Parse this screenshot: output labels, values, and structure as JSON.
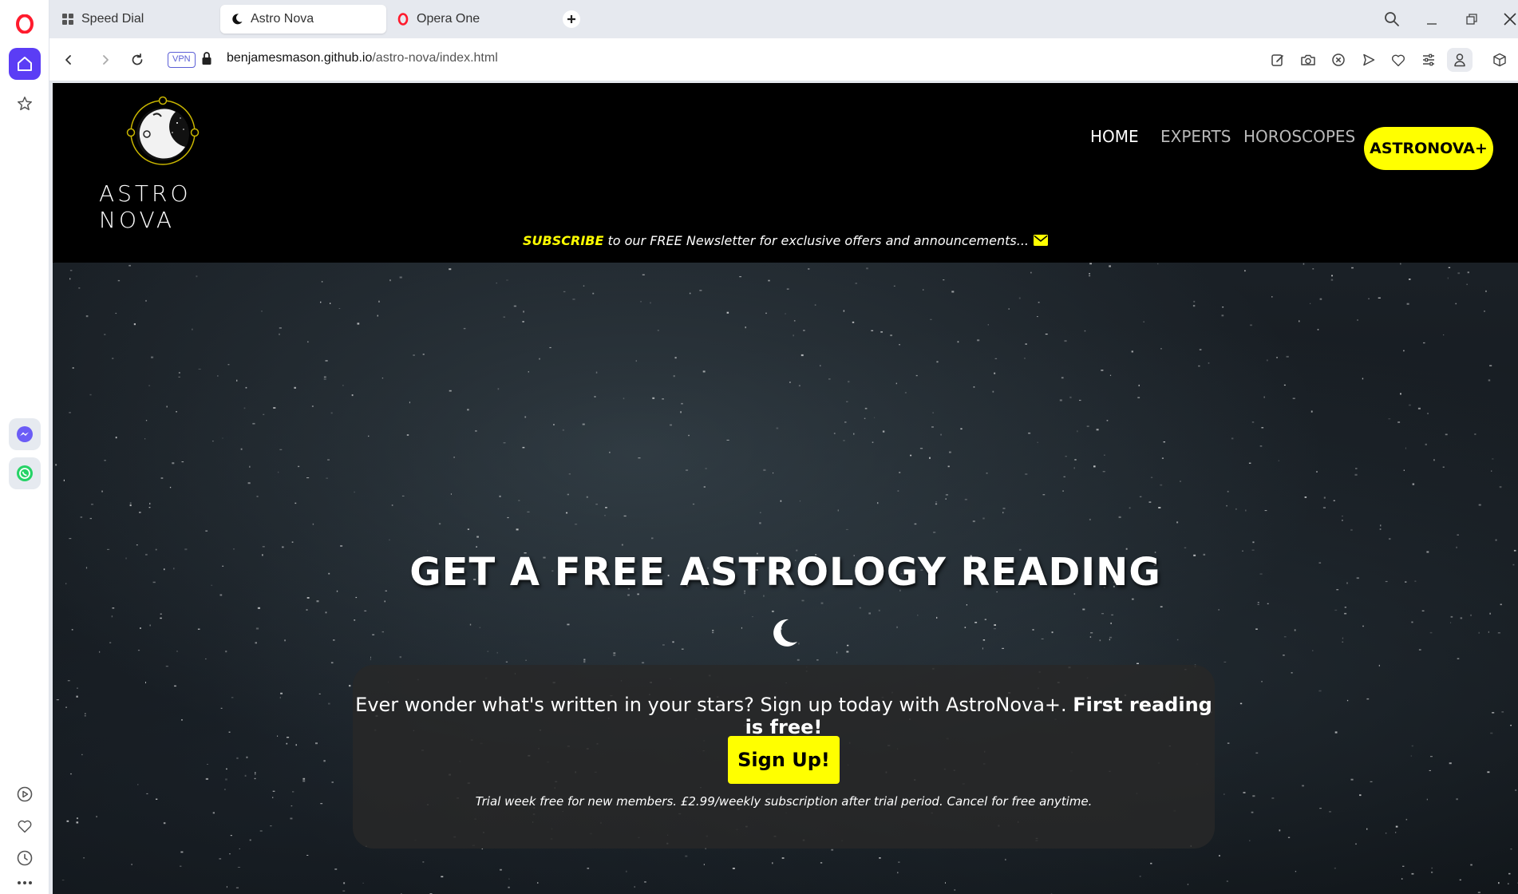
{
  "browser": {
    "tabs": [
      {
        "label": "Speed Dial",
        "icon": "grid-icon"
      },
      {
        "label": "Astro Nova",
        "icon": "moon-icon",
        "active": true
      },
      {
        "label": "Opera One",
        "icon": "opera-icon"
      }
    ],
    "vpn_label": "VPN",
    "url_host": "benjamesmason.github.io",
    "url_path": "/astro-nova/index.html"
  },
  "site": {
    "logo_text": "ASTRO NOVA",
    "nav": {
      "home": "HOME",
      "experts": "EXPERTS",
      "horoscopes": "HOROSCOPES",
      "plus": "ASTRONOVA+"
    },
    "subscribe_strong": "SUBSCRIBE",
    "subscribe_rest": " to our FREE Newsletter for exclusive offers and announcements...",
    "hero_title": "GET A FREE ASTROLOGY READING",
    "card_text": "Ever wonder what's written in your stars? Sign up today with AstroNova+. ",
    "card_text_strong": "First reading is free!",
    "signup_label": "Sign Up!",
    "fine_print": "Trial week free for new members. £2.99/weekly subscription after trial period. Cancel for free anytime."
  },
  "colors": {
    "accent": "#ffff00",
    "opera_red": "#ff1b2d",
    "sidebar_active": "#5b3df5"
  }
}
